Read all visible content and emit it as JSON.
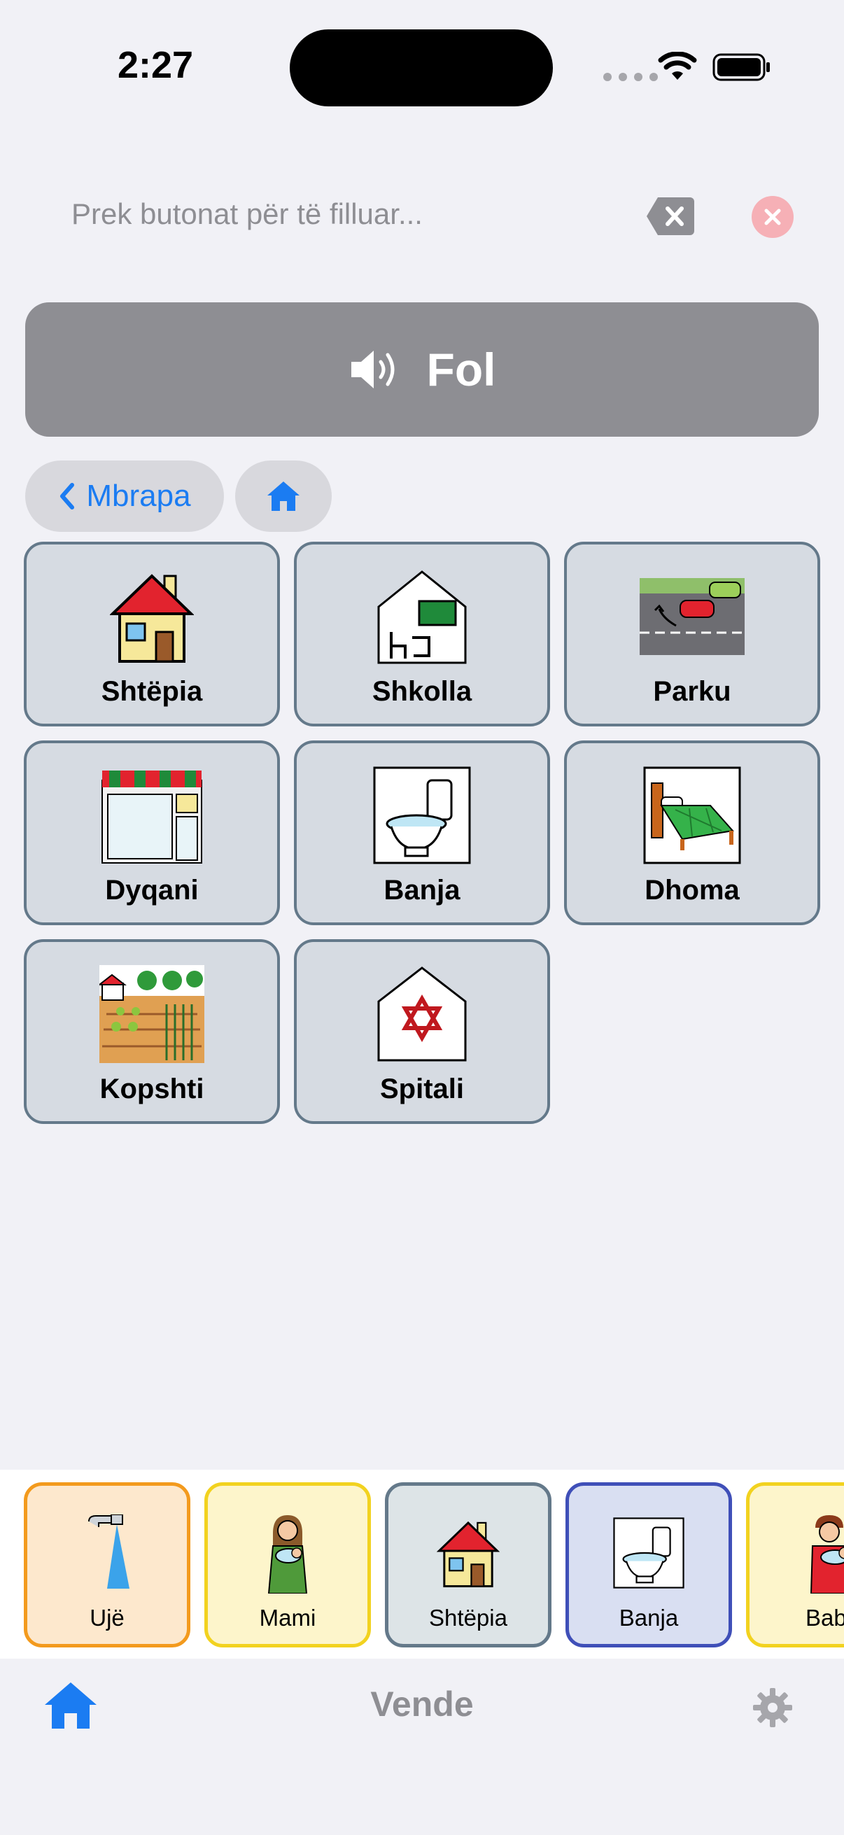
{
  "status": {
    "time": "2:27"
  },
  "input": {
    "placeholder": "Prek butonat për të filluar..."
  },
  "speak": {
    "label": "Fol",
    "icon": "speaker-icon"
  },
  "nav": {
    "back_label": "Mbrapa",
    "home_icon": "home-icon"
  },
  "tiles": [
    {
      "label": "Shtëpia",
      "icon": "house-icon"
    },
    {
      "label": "Shkolla",
      "icon": "school-icon"
    },
    {
      "label": "Parku",
      "icon": "park-icon"
    },
    {
      "label": "Dyqani",
      "icon": "shop-icon"
    },
    {
      "label": "Banja",
      "icon": "toilet-icon"
    },
    {
      "label": "Dhoma",
      "icon": "bed-icon"
    },
    {
      "label": "Kopshti",
      "icon": "garden-icon"
    },
    {
      "label": "Spitali",
      "icon": "hospital-icon"
    }
  ],
  "quickbar": [
    {
      "label": "Ujë",
      "icon": "water-tap-icon",
      "bg": "#fde8cd",
      "border": "#f39a1d"
    },
    {
      "label": "Mami",
      "icon": "mother-icon",
      "bg": "#fdf5cb",
      "border": "#f2d21f"
    },
    {
      "label": "Shtëpia",
      "icon": "house-icon",
      "bg": "#dde4e7",
      "border": "#64798a"
    },
    {
      "label": "Banja",
      "icon": "toilet-icon",
      "bg": "#d9dff2",
      "border": "#3f4fb8"
    },
    {
      "label": "Bab",
      "icon": "father-icon",
      "bg": "#fdf5cb",
      "border": "#f2d21f"
    }
  ],
  "bottom": {
    "title": "Vende"
  },
  "colors": {
    "accent": "#1b7cf2",
    "speak_bg": "#8e8e93",
    "tile_bg": "#d6dbe2",
    "tile_border": "#64798a"
  }
}
